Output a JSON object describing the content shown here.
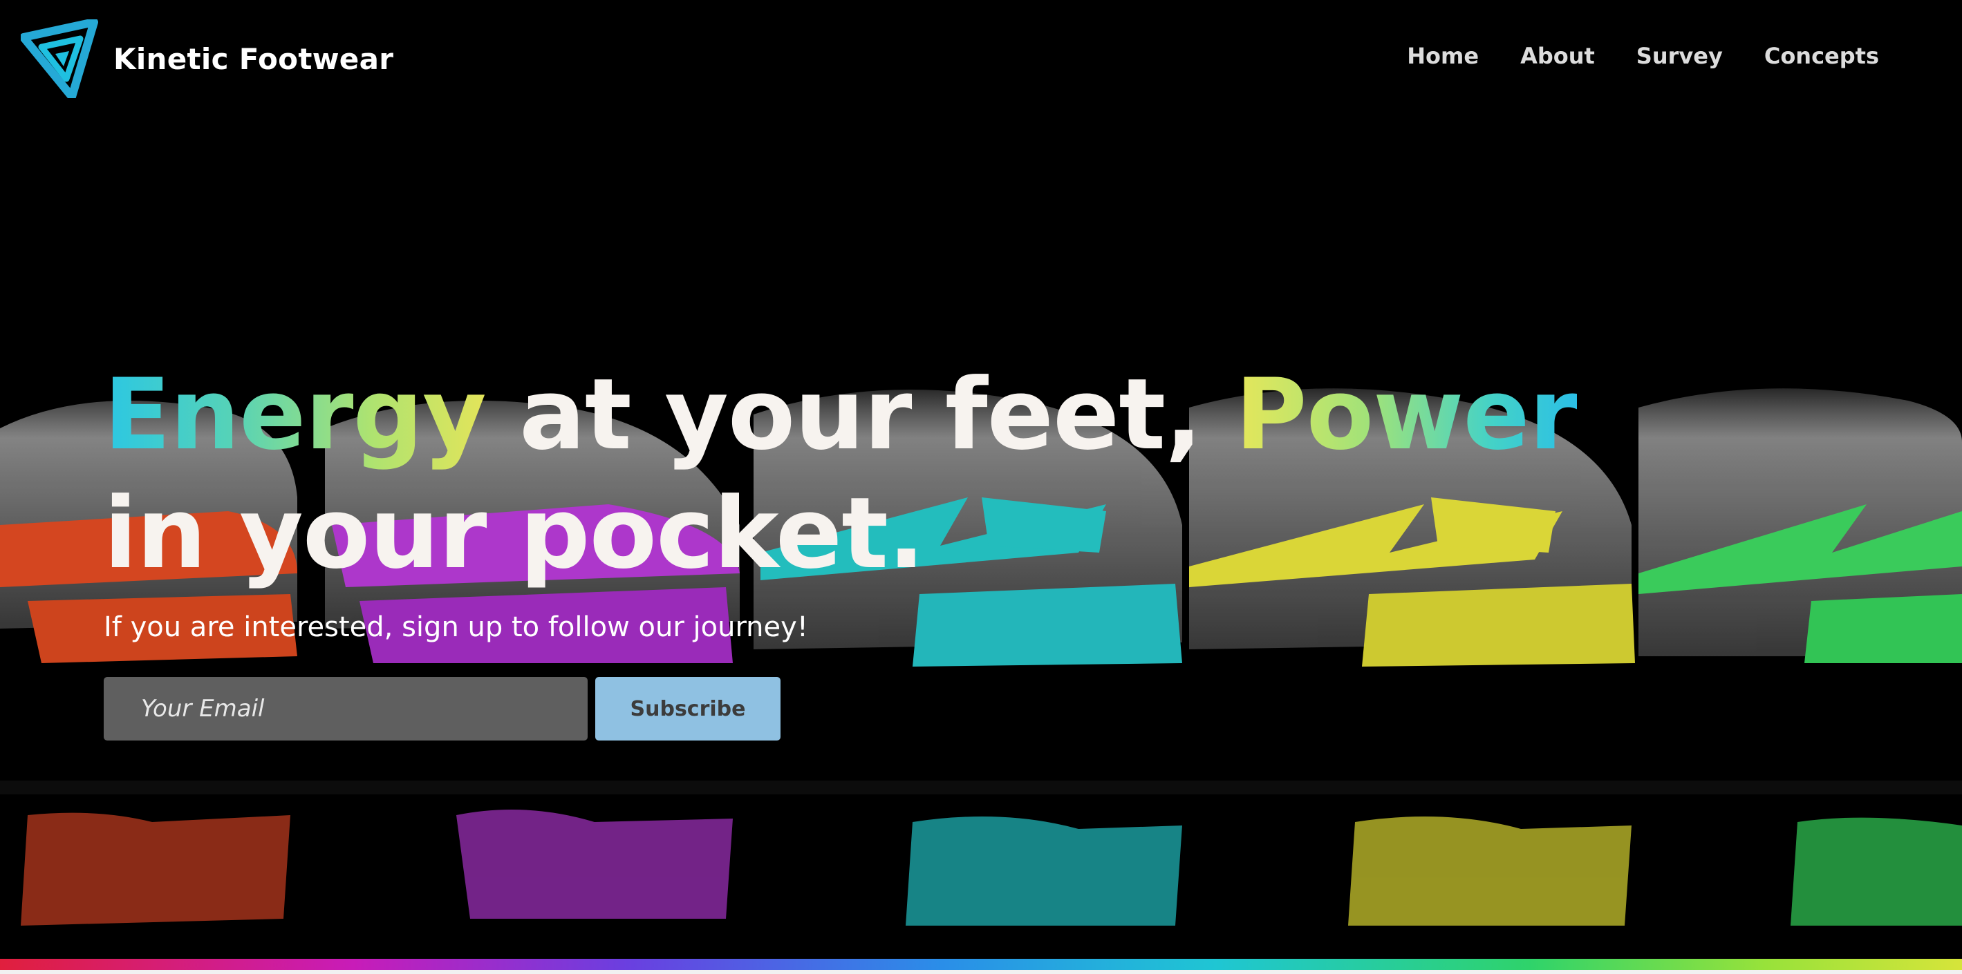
{
  "brand": {
    "name": "Kinetic Footwear",
    "logo_icon": "triangle-spiral-logo-icon"
  },
  "nav": {
    "items": [
      {
        "label": "Home"
      },
      {
        "label": "About"
      },
      {
        "label": "Survey"
      },
      {
        "label": "Concepts"
      }
    ]
  },
  "hero": {
    "headline_part1": "Energy",
    "headline_part2": " at your feet, ",
    "headline_part3": "Power",
    "headline_part4": " in your pocket.",
    "subtitle": "If you are interested, sign up to follow our journey!",
    "email_placeholder": "Your Email",
    "email_value": "",
    "subscribe_label": "Subscribe",
    "background_image": "shoes-lineup-reflection"
  },
  "colors": {
    "background": "#000000",
    "accent_cyan": "#2bc7e3",
    "accent_yellow": "#e3e45a",
    "accent_green": "#9fe27a",
    "input_bg": "#5f5f5f",
    "button_bg": "#8fc1e2",
    "shoe_red": "#e04a22",
    "shoe_purple": "#b73ad6",
    "shoe_teal": "#25c8c8",
    "shoe_yellow": "#e6e23a",
    "shoe_green": "#3ed660"
  }
}
